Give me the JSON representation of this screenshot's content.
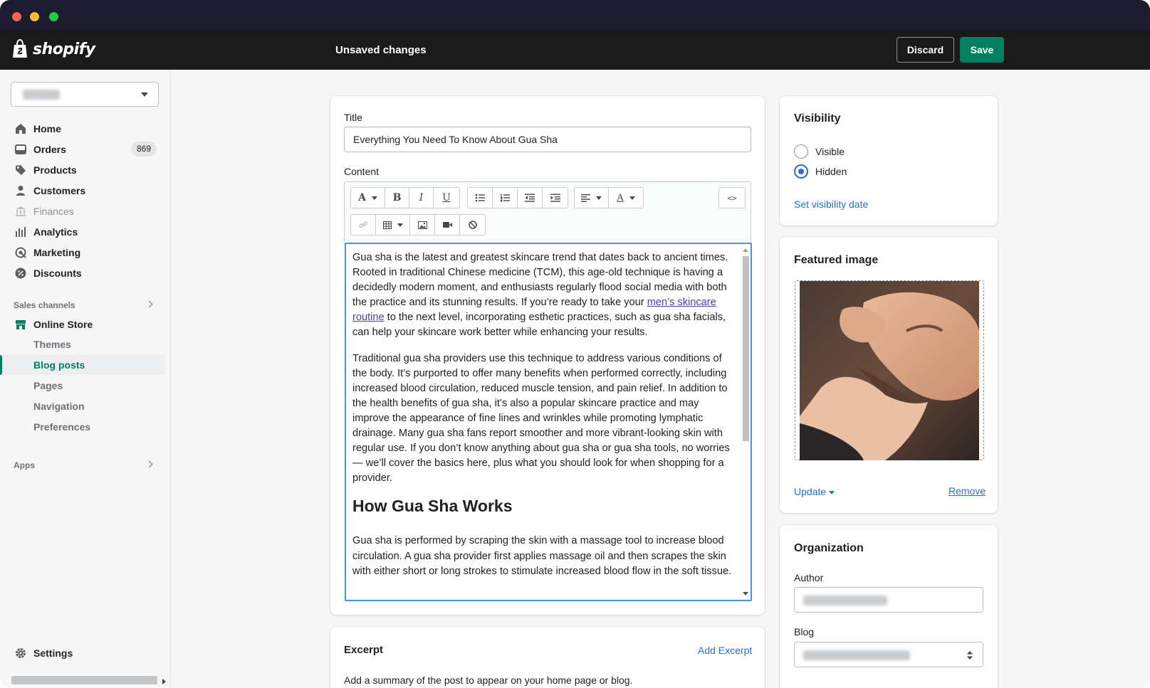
{
  "topbar": {
    "logo_text": "shopify",
    "status": "Unsaved changes",
    "discard_label": "Discard",
    "save_label": "Save"
  },
  "sidebar": {
    "nav": [
      {
        "label": "Home",
        "icon": "home-icon"
      },
      {
        "label": "Orders",
        "icon": "orders-icon",
        "badge": "869"
      },
      {
        "label": "Products",
        "icon": "tag-icon"
      },
      {
        "label": "Customers",
        "icon": "person-icon"
      },
      {
        "label": "Finances",
        "icon": "bank-icon",
        "disabled": true
      },
      {
        "label": "Analytics",
        "icon": "bar-chart-icon"
      },
      {
        "label": "Marketing",
        "icon": "target-icon"
      },
      {
        "label": "Discounts",
        "icon": "discount-icon"
      }
    ],
    "sales_channels_label": "Sales channels",
    "online_store_label": "Online Store",
    "online_store_sub": [
      "Themes",
      "Blog posts",
      "Pages",
      "Navigation",
      "Preferences"
    ],
    "active_sub": "Blog posts",
    "apps_label": "Apps",
    "settings_label": "Settings"
  },
  "editor": {
    "title_label": "Title",
    "title_value": "Everything You Need To Know About Gua Sha",
    "content_label": "Content",
    "p1_before": "Gua sha is the latest and greatest skincare trend that dates back to ancient times. Rooted in traditional Chinese medicine (TCM), this age-old technique is having a decidedly modern moment, and enthusiasts regularly flood social media with both the practice and its stunning results. If you’re ready to take your ",
    "p1_link": "men’s skincare routine",
    "p1_after": " to the next level, incorporating esthetic practices, such as gua sha facials, can help your skincare work better while enhancing your results.",
    "p2": "Traditional gua sha providers use this technique to address various conditions of the body. It’s purported to offer many benefits when performed correctly, including increased blood circulation, reduced muscle tension, and pain relief. In addition to the health benefits of gua sha, it’s also a popular skincare practice and may improve the appearance of fine lines and wrinkles while promoting lymphatic drainage. Many gua sha fans report smoother and more vibrant-looking skin with regular use. If you don’t know anything about gua sha or gua sha tools, no worries — we’ll cover the basics here, plus what you should look for when shopping for a provider.",
    "h2": "How Gua Sha Works",
    "p3": "Gua sha is performed by scraping the skin with a massage tool to increase blood circulation. A gua sha provider first applies massage oil and then scrapes the skin with either short or long strokes to stimulate increased blood flow in the soft tissue."
  },
  "excerpt": {
    "title": "Excerpt",
    "add_label": "Add Excerpt",
    "help": "Add a summary of the post to appear on your home page or blog."
  },
  "visibility": {
    "title": "Visibility",
    "options": [
      "Visible",
      "Hidden"
    ],
    "selected": "Hidden",
    "set_date_label": "Set visibility date"
  },
  "featured_image": {
    "title": "Featured image",
    "update_label": "Update",
    "remove_label": "Remove"
  },
  "organization": {
    "title": "Organization",
    "author_label": "Author",
    "blog_label": "Blog"
  },
  "colors": {
    "accent": "#008060",
    "link": "#2c6ecb",
    "topbar": "#1a1a1a"
  }
}
